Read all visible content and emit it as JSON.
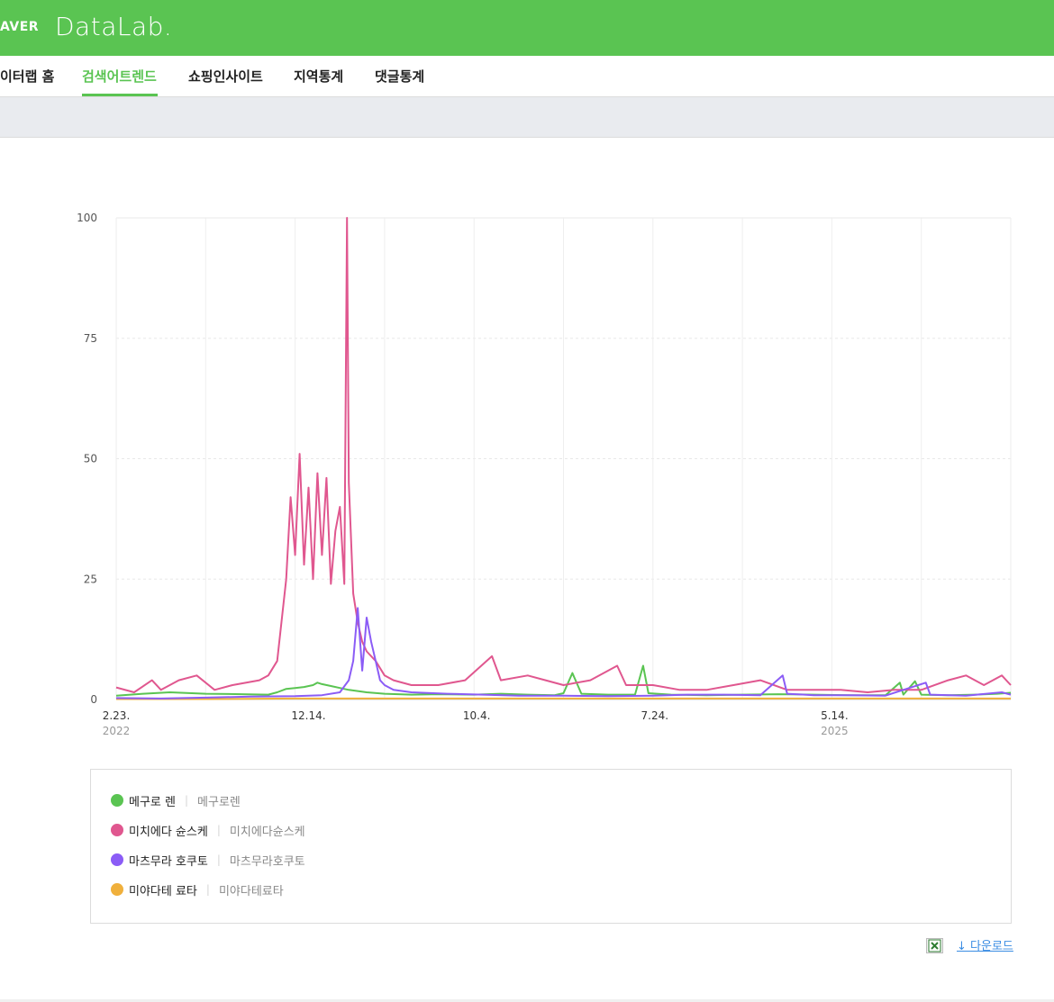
{
  "header": {
    "brand": "AVER",
    "product": "DataLab."
  },
  "nav": {
    "items": [
      {
        "label": "이터랩 홈"
      },
      {
        "label": "검색어트렌드"
      },
      {
        "label": "쇼핑인사이트"
      },
      {
        "label": "지역통계"
      },
      {
        "label": "댓글통계"
      }
    ],
    "active_index": 1
  },
  "legend": [
    {
      "name": "메구로 렌",
      "keywords": "메구로렌",
      "color": "#5ac452"
    },
    {
      "name": "미치에다 슌스케",
      "keywords": "미치에다슌스케",
      "color": "#e0578f"
    },
    {
      "name": "마츠무라 호쿠토",
      "keywords": "마츠무라호쿠토",
      "color": "#8b5cf6"
    },
    {
      "name": "미야다테 료타",
      "keywords": "미야다테료타",
      "color": "#f0b03c"
    }
  ],
  "actions": {
    "download_label": "다운로드",
    "excel_icon": "excel-icon"
  },
  "chart_data": {
    "type": "line",
    "ylim": [
      0,
      100
    ],
    "yticks": [
      0,
      25,
      50,
      75,
      100
    ],
    "xticks": [
      {
        "label": "2.23.",
        "year": "2022",
        "t": 0
      },
      {
        "label": "12.14.",
        "year": "",
        "t": 0.215
      },
      {
        "label": "10.4.",
        "year": "",
        "t": 0.403
      },
      {
        "label": "7.24.",
        "year": "",
        "t": 0.602
      },
      {
        "label": "5.14.",
        "year": "2025",
        "t": 0.803
      }
    ],
    "series": [
      {
        "name": "메구로 렌",
        "color": "#5ac452",
        "points": [
          [
            0,
            0.8
          ],
          [
            0.03,
            1.2
          ],
          [
            0.06,
            1.5
          ],
          [
            0.1,
            1.2
          ],
          [
            0.14,
            1.1
          ],
          [
            0.17,
            1.0
          ],
          [
            0.18,
            1.5
          ],
          [
            0.19,
            2.2
          ],
          [
            0.2,
            2.4
          ],
          [
            0.21,
            2.6
          ],
          [
            0.22,
            3.0
          ],
          [
            0.225,
            3.5
          ],
          [
            0.23,
            3.2
          ],
          [
            0.24,
            2.8
          ],
          [
            0.25,
            2.4
          ],
          [
            0.26,
            2.0
          ],
          [
            0.28,
            1.5
          ],
          [
            0.3,
            1.2
          ],
          [
            0.33,
            1.0
          ],
          [
            0.36,
            1.1
          ],
          [
            0.4,
            1.0
          ],
          [
            0.43,
            1.2
          ],
          [
            0.46,
            1.0
          ],
          [
            0.49,
            0.9
          ],
          [
            0.5,
            1.3
          ],
          [
            0.51,
            5.5
          ],
          [
            0.52,
            1.2
          ],
          [
            0.55,
            1.0
          ],
          [
            0.58,
            1.0
          ],
          [
            0.589,
            7.0
          ],
          [
            0.595,
            1.3
          ],
          [
            0.62,
            1.0
          ],
          [
            0.66,
            0.9
          ],
          [
            0.7,
            1.0
          ],
          [
            0.74,
            1.1
          ],
          [
            0.78,
            1.0
          ],
          [
            0.82,
            0.9
          ],
          [
            0.86,
            0.9
          ],
          [
            0.876,
            3.5
          ],
          [
            0.88,
            1.0
          ],
          [
            0.893,
            3.8
          ],
          [
            0.9,
            1.0
          ],
          [
            0.93,
            0.9
          ],
          [
            0.96,
            1.0
          ],
          [
            0.985,
            1.2
          ],
          [
            1.0,
            1.4
          ]
        ]
      },
      {
        "name": "미치에다 슌스케",
        "color": "#e0578f",
        "points": [
          [
            0,
            2.5
          ],
          [
            0.02,
            1.5
          ],
          [
            0.04,
            4
          ],
          [
            0.05,
            2
          ],
          [
            0.07,
            4
          ],
          [
            0.09,
            5
          ],
          [
            0.11,
            2
          ],
          [
            0.13,
            3
          ],
          [
            0.16,
            4
          ],
          [
            0.17,
            5
          ],
          [
            0.18,
            8
          ],
          [
            0.19,
            25
          ],
          [
            0.195,
            42
          ],
          [
            0.2,
            30
          ],
          [
            0.205,
            51
          ],
          [
            0.21,
            28
          ],
          [
            0.215,
            44
          ],
          [
            0.22,
            25
          ],
          [
            0.225,
            47
          ],
          [
            0.23,
            30
          ],
          [
            0.235,
            46
          ],
          [
            0.24,
            24
          ],
          [
            0.245,
            35
          ],
          [
            0.25,
            40
          ],
          [
            0.255,
            24
          ],
          [
            0.258,
            100
          ],
          [
            0.26,
            45
          ],
          [
            0.265,
            22
          ],
          [
            0.27,
            16
          ],
          [
            0.275,
            12
          ],
          [
            0.28,
            10
          ],
          [
            0.29,
            8
          ],
          [
            0.3,
            5
          ],
          [
            0.31,
            4
          ],
          [
            0.33,
            3
          ],
          [
            0.36,
            3
          ],
          [
            0.39,
            4
          ],
          [
            0.42,
            9
          ],
          [
            0.43,
            4
          ],
          [
            0.46,
            5
          ],
          [
            0.48,
            4
          ],
          [
            0.5,
            3
          ],
          [
            0.53,
            4
          ],
          [
            0.56,
            7
          ],
          [
            0.57,
            3
          ],
          [
            0.6,
            3
          ],
          [
            0.63,
            2
          ],
          [
            0.66,
            2
          ],
          [
            0.69,
            3
          ],
          [
            0.72,
            4
          ],
          [
            0.75,
            2
          ],
          [
            0.78,
            2
          ],
          [
            0.81,
            2
          ],
          [
            0.84,
            1.5
          ],
          [
            0.87,
            2
          ],
          [
            0.9,
            2
          ],
          [
            0.93,
            4
          ],
          [
            0.95,
            5
          ],
          [
            0.97,
            3
          ],
          [
            0.99,
            5
          ],
          [
            1.0,
            3
          ]
        ]
      },
      {
        "name": "마츠무라 호쿠토",
        "color": "#8b5cf6",
        "points": [
          [
            0,
            0.3
          ],
          [
            0.05,
            0.2
          ],
          [
            0.1,
            0.4
          ],
          [
            0.15,
            0.6
          ],
          [
            0.2,
            0.7
          ],
          [
            0.23,
            0.9
          ],
          [
            0.25,
            1.5
          ],
          [
            0.26,
            4
          ],
          [
            0.265,
            8
          ],
          [
            0.27,
            19
          ],
          [
            0.275,
            6
          ],
          [
            0.28,
            17
          ],
          [
            0.285,
            12
          ],
          [
            0.29,
            8
          ],
          [
            0.295,
            4
          ],
          [
            0.3,
            3
          ],
          [
            0.31,
            2
          ],
          [
            0.33,
            1.5
          ],
          [
            0.37,
            1.2
          ],
          [
            0.41,
            1.0
          ],
          [
            0.45,
            0.8
          ],
          [
            0.5,
            0.8
          ],
          [
            0.55,
            0.7
          ],
          [
            0.6,
            0.8
          ],
          [
            0.64,
            1.0
          ],
          [
            0.68,
            1.0
          ],
          [
            0.72,
            0.9
          ],
          [
            0.745,
            5
          ],
          [
            0.75,
            1.2
          ],
          [
            0.78,
            0.9
          ],
          [
            0.82,
            0.9
          ],
          [
            0.86,
            0.8
          ],
          [
            0.905,
            3.5
          ],
          [
            0.91,
            1.0
          ],
          [
            0.95,
            0.8
          ],
          [
            0.99,
            1.5
          ],
          [
            1.0,
            1.0
          ]
        ]
      },
      {
        "name": "미야다테 료타",
        "color": "#f0b03c",
        "points": [
          [
            0,
            0.1
          ],
          [
            0.1,
            0.1
          ],
          [
            0.2,
            0.2
          ],
          [
            0.3,
            0.2
          ],
          [
            0.4,
            0.2
          ],
          [
            0.5,
            0.2
          ],
          [
            0.6,
            0.2
          ],
          [
            0.7,
            0.2
          ],
          [
            0.8,
            0.2
          ],
          [
            0.9,
            0.2
          ],
          [
            1.0,
            0.2
          ]
        ]
      }
    ]
  }
}
